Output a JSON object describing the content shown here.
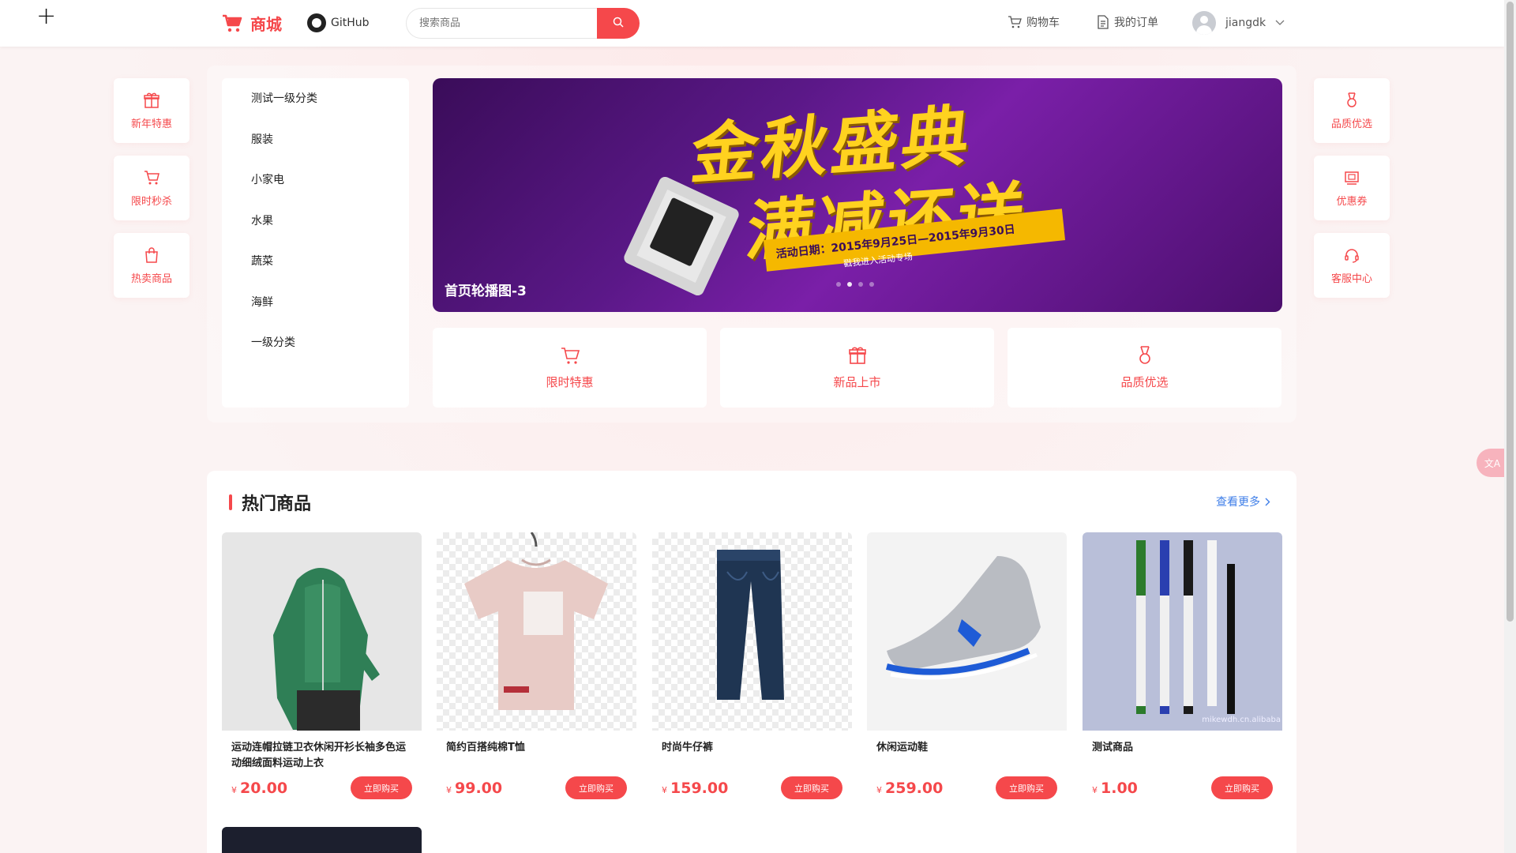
{
  "header": {
    "brand": "商城",
    "github": "GitHub",
    "search_placeholder": "搜索商品",
    "cart": "购物车",
    "orders": "我的订单",
    "user": "jiangdk"
  },
  "left_shortcuts": [
    {
      "label": "新年特惠",
      "icon": "gift-icon"
    },
    {
      "label": "限时秒杀",
      "icon": "cart-icon"
    },
    {
      "label": "热卖商品",
      "icon": "bag-icon"
    }
  ],
  "right_shortcuts": [
    {
      "label": "品质优选",
      "icon": "medal-icon"
    },
    {
      "label": "优惠券",
      "icon": "coupon-icon"
    },
    {
      "label": "客服中心",
      "icon": "headset-icon"
    }
  ],
  "categories": [
    "测试一级分类",
    "服装",
    "小家电",
    "水果",
    "蔬菜",
    "海鲜",
    "一级分类"
  ],
  "banner": {
    "caption": "首页轮播图-3",
    "headline1": "金秋盛典",
    "headline2": "满减还送",
    "date_text": "活动日期：2015年9月25日—2015年9月30日",
    "sub_text": "戳我进入活动专场",
    "dot_count": 4,
    "active_dot": 1
  },
  "features": [
    {
      "label": "限时特惠",
      "icon": "cart-icon"
    },
    {
      "label": "新品上市",
      "icon": "gift-icon"
    },
    {
      "label": "品质优选",
      "icon": "medal-icon"
    }
  ],
  "hot": {
    "title": "热门商品",
    "more": "查看更多",
    "currency": "¥",
    "buy_label": "立即购买",
    "products": [
      {
        "name": "运动连帽拉链卫衣休闲开衫长袖多色运动细绒面料运动上衣",
        "price": "20.00"
      },
      {
        "name": "简约百搭纯棉T恤",
        "price": "99.00"
      },
      {
        "name": "时尚牛仔裤",
        "price": "159.00"
      },
      {
        "name": "休闲运动鞋",
        "price": "259.00"
      },
      {
        "name": "测试商品",
        "price": "1.00"
      }
    ],
    "watermark": "mikewdh.cn.alibaba"
  },
  "colors": {
    "accent": "#f5484b",
    "link": "#3e7ee8"
  }
}
